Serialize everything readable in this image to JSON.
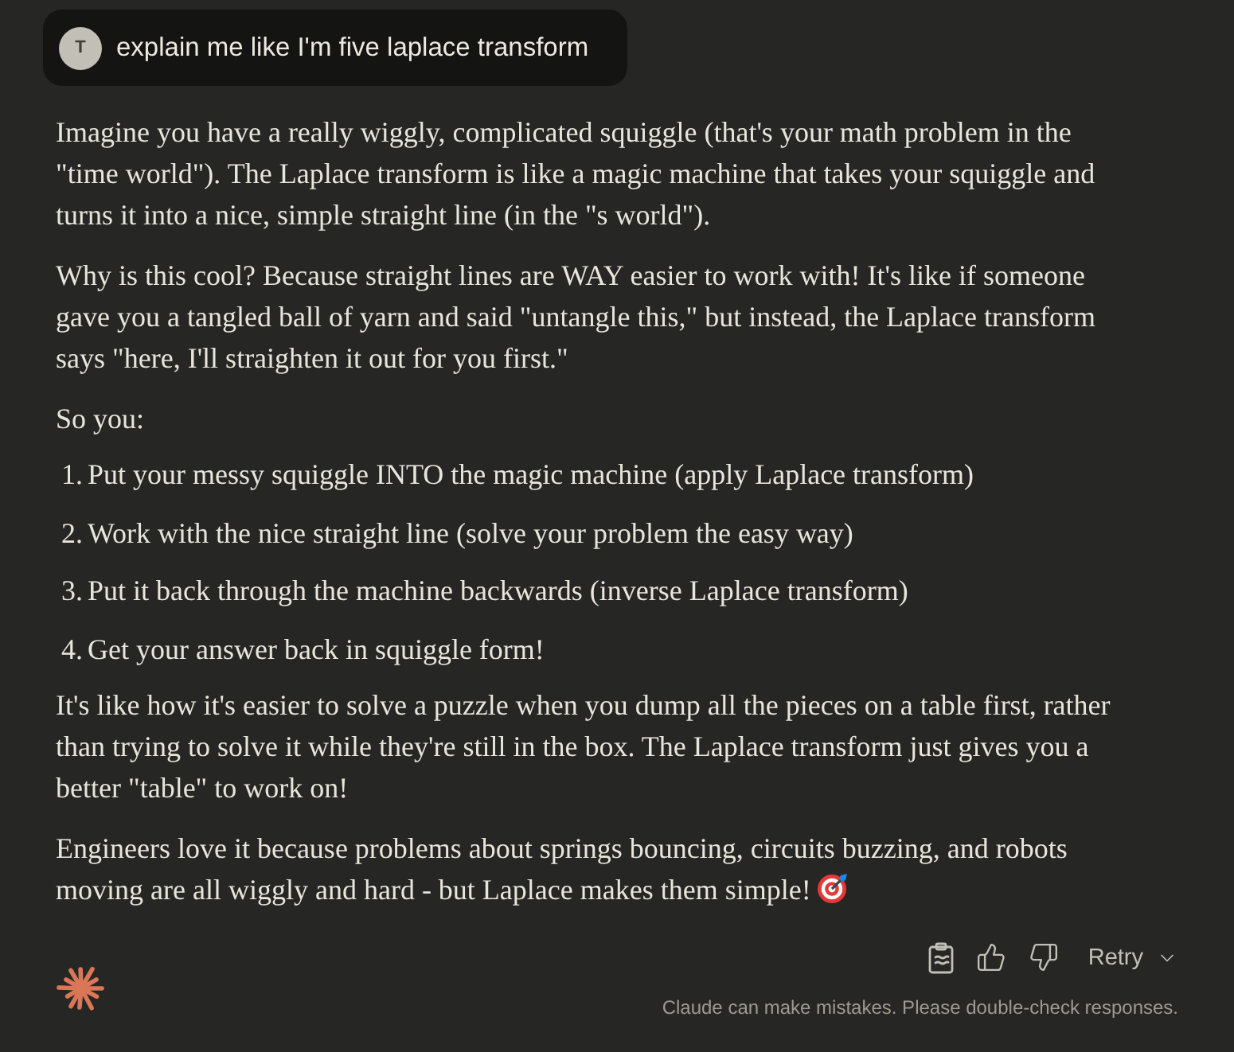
{
  "user_message": {
    "avatar_initial": "T",
    "text": "explain me like I'm five laplace transform"
  },
  "response": {
    "blocks": [
      {
        "kind": "paragraph",
        "text": "Imagine you have a really wiggly, complicated squiggle (that's your math problem in the \"time world\"). The Laplace transform is like a magic machine that takes your squiggle and turns it into a nice, simple straight line (in the \"s world\")."
      },
      {
        "kind": "paragraph",
        "text": "Why is this cool? Because straight lines are WAY easier to work with! It's like if someone gave you a tangled ball of yarn and said \"untangle this,\" but instead, the Laplace transform says \"here, I'll straighten it out for you first.\""
      },
      {
        "kind": "paragraph",
        "text": "So you:"
      },
      {
        "kind": "list",
        "items": [
          {
            "number": "1.",
            "text": "Put your messy squiggle INTO the magic machine (apply Laplace transform)"
          },
          {
            "number": "2.",
            "text": "Work with the nice straight line (solve your problem the easy way)"
          },
          {
            "number": "3.",
            "text": "Put it back through the machine backwards (inverse Laplace transform)"
          },
          {
            "number": "4.",
            "text": "Get your answer back in squiggle form!"
          }
        ]
      },
      {
        "kind": "paragraph",
        "text": "It's like how it's easier to solve a puzzle when you dump all the pieces on a table first, rather than trying to solve it while they're still in the box. The Laplace transform just gives you a better \"table\" to work on!"
      },
      {
        "kind": "paragraph",
        "text": "Engineers love it because problems about springs bouncing, circuits buzzing, and robots moving are all wiggly and hard - but Laplace makes them simple!",
        "trailing_emoji": true
      }
    ]
  },
  "actions": {
    "retry_label": "Retry"
  },
  "disclaimer": "Claude can make mistakes. Please double-check responses."
}
